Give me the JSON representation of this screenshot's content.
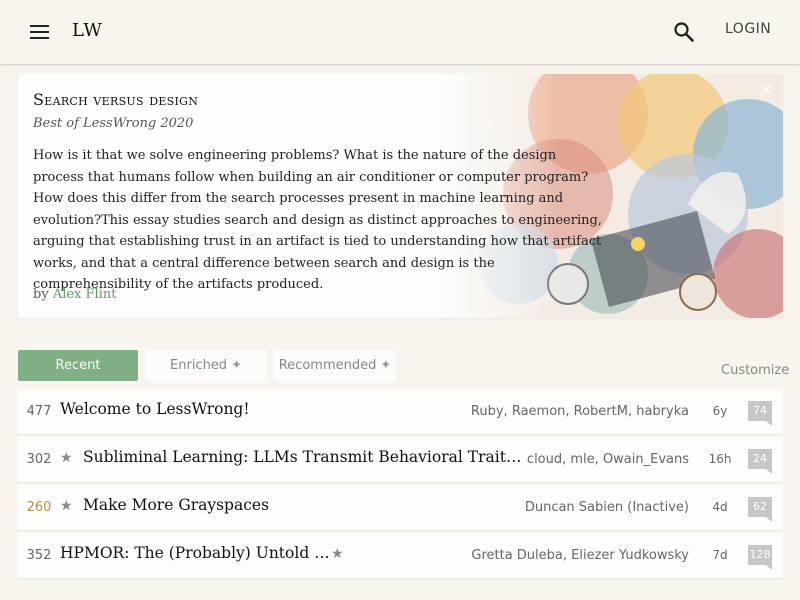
{
  "header": {
    "logo": "LW",
    "login_label": "LOGIN",
    "icons": {
      "menu": "hamburger-menu-icon",
      "search": "search-icon"
    }
  },
  "spotlight": {
    "title": "Search versus design",
    "subtitle": "Best of LessWrong 2020",
    "description": "How is it that we solve engineering problems? What is the nature of the design process that humans follow when building an air conditioner or computer program? How does this differ from the search processes present in machine learning and evolution?This essay studies search and design as distinct approaches to engineering, arguing that establishing trust in an artifact is tied to understanding how that artifact works, and that a central difference between search and design is the comprehensibility of the artifacts produced.",
    "by_label": "by",
    "author": "Alex Flint",
    "close_glyph": "×"
  },
  "tabs": [
    {
      "label": "Recent",
      "active": true
    },
    {
      "label": "Enriched",
      "active": false,
      "icon": "sparkle-icon"
    },
    {
      "label": "Recommended",
      "active": false,
      "icon": "sparkle-icon"
    }
  ],
  "customize_label": "Customize",
  "posts": [
    {
      "karma": "477",
      "starred": false,
      "title": "Welcome to LessWrong!",
      "authors": "Ruby, Raemon, RobertM, habryka",
      "age": "6y",
      "comments": "74"
    },
    {
      "karma": "302",
      "starred": true,
      "title": "Subliminal Learning: LLMs Transmit Behavioral Traits via Hidden Signals in Data",
      "authors": "cloud, mle, Owain_Evans",
      "age": "16h",
      "comments": "24"
    },
    {
      "karma": "260",
      "starred": true,
      "karma_color": "#b5923b",
      "title": "Make More Grayspaces",
      "authors": "Duncan Sabien (Inactive)",
      "age": "4d",
      "comments": "62"
    },
    {
      "karma": "352",
      "starred": true,
      "star_after_title": true,
      "title": "HPMOR: The (Probably) Untold Lore",
      "authors": "Gretta Duleba, Eliezer Yudkowsky",
      "age": "7d",
      "comments": "128"
    }
  ],
  "colors": {
    "accent": "#7faf83",
    "author_link": "#5e9b67",
    "background": "#f8f4ee"
  }
}
